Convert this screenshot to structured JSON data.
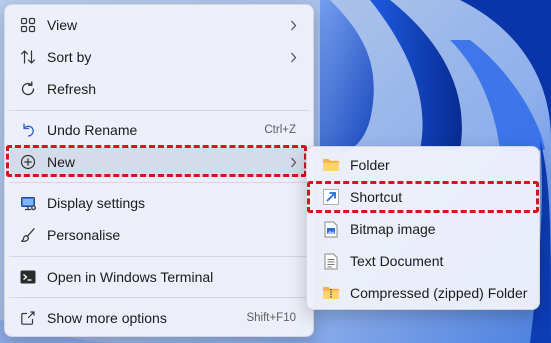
{
  "context_menu": {
    "items": [
      {
        "label": "View",
        "icon": "grid-view-icon",
        "has_submenu": true
      },
      {
        "label": "Sort by",
        "icon": "sort-icon",
        "has_submenu": true
      },
      {
        "label": "Refresh",
        "icon": "refresh-icon"
      },
      {
        "label": "Undo Rename",
        "icon": "undo-icon",
        "shortcut": "Ctrl+Z"
      },
      {
        "label": "New",
        "icon": "plus-circle-icon",
        "has_submenu": true,
        "highlighted": true
      },
      {
        "label": "Display settings",
        "icon": "display-icon"
      },
      {
        "label": "Personalise",
        "icon": "brush-icon"
      },
      {
        "label": "Open in Windows Terminal",
        "icon": "terminal-icon"
      },
      {
        "label": "Show more options",
        "icon": "share-icon",
        "shortcut": "Shift+F10"
      }
    ]
  },
  "new_submenu": {
    "items": [
      {
        "label": "Folder",
        "icon": "folder-icon"
      },
      {
        "label": "Shortcut",
        "icon": "shortcut-icon",
        "highlighted": true
      },
      {
        "label": "Bitmap image",
        "icon": "bitmap-image-icon"
      },
      {
        "label": "Text Document",
        "icon": "text-document-icon"
      },
      {
        "label": "Compressed (zipped) Folder",
        "icon": "zip-folder-icon"
      }
    ]
  },
  "colors": {
    "menu_background": "#eef1fa",
    "highlight_outline": "#d5141e",
    "wallpaper_accent": "#1a4fd0"
  }
}
